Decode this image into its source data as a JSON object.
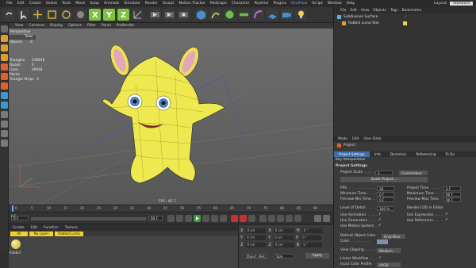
{
  "menubar": {
    "items": [
      "File",
      "Edit",
      "Create",
      "Select",
      "Tools",
      "Mesh",
      "Snap",
      "Animate",
      "Simulate",
      "Render",
      "Sculpt",
      "Motion Tracker",
      "MoGraph",
      "Character",
      "Pipeline",
      "Plugins",
      "RealFlow",
      "Script",
      "Window",
      "Help"
    ],
    "layout_label": "Layout:",
    "layout_value": "Standard"
  },
  "viewport": {
    "menu": [
      "View",
      "Cameras",
      "Display",
      "Options",
      "Filter",
      "Panel",
      "ProRender"
    ],
    "view_name": "Perspective",
    "hud_tab": "Total",
    "stats": [
      {
        "label": "Objects",
        "value": "0"
      },
      {
        "label": "Triangles",
        "value": "130816"
      },
      {
        "label": "Quads",
        "value": "0"
      },
      {
        "label": "Lines",
        "value": "48064"
      },
      {
        "label": "Points",
        "value": ""
      },
      {
        "label": "Triangle Strips",
        "value": "0"
      }
    ],
    "fps": "FPS : 85.7"
  },
  "timeline": {
    "ticks": [
      "0",
      "5",
      "10",
      "15",
      "20",
      "25",
      "30",
      "35",
      "40",
      "45",
      "50",
      "55",
      "60",
      "65",
      "70",
      "75",
      "80",
      "85",
      "90"
    ],
    "start": "0 F",
    "end": "90 F",
    "end2": "90 F",
    "frame": "0 F"
  },
  "material": {
    "menu": [
      "Create",
      "Edit",
      "Function",
      "Texture"
    ],
    "filters": [
      "All",
      "No Layer",
      "Rabbid Luma"
    ],
    "mat_name": "Rabbid"
  },
  "coords": {
    "rows": [
      {
        "a": "X",
        "v1": "0 cm",
        "b": "X",
        "v2": "0 cm",
        "c": "H",
        "v3": "0 °"
      },
      {
        "a": "Y",
        "v1": "0 cm",
        "b": "Y",
        "v2": "0 cm",
        "c": "P",
        "v3": "0 °"
      },
      {
        "a": "Z",
        "v1": "0 cm",
        "b": "Z",
        "v2": "0 cm",
        "c": "B",
        "v3": "0 °"
      }
    ],
    "dd1": "Object (Rel)",
    "dd2": "Size",
    "apply": "Apply"
  },
  "objects": {
    "menu": [
      "File",
      "Edit",
      "View",
      "Objects",
      "Tags",
      "Bookmarks"
    ],
    "rows": [
      "Subdivision Surface",
      "Rabbid Luma Star"
    ]
  },
  "attributes": {
    "menu": [
      "Mode",
      "Edit",
      "User Data"
    ],
    "title": "Project",
    "tabs": [
      "Project Settings",
      "Info",
      "Dynamics",
      "Referencing",
      "To Do"
    ],
    "tab2": "Key Interpolation",
    "section": "Project Settings",
    "project_scale_label": "Project Scale . . . . . .",
    "project_scale": "1",
    "unit": "Centimeters",
    "scale_btn": "Scale Project...",
    "left": [
      {
        "l": "FPS . . . . . . . . . . . . .",
        "v": "30"
      },
      {
        "l": "Minimum Time . . . . . .",
        "v": "0 F"
      },
      {
        "l": "Preview Min Time . . . .",
        "v": "0 F"
      }
    ],
    "right": [
      {
        "l": "Project Time . . . . .",
        "v": "0 F"
      },
      {
        "l": "Maximum Time . . . .",
        "v": "90 F"
      },
      {
        "l": "Preview Max Time .",
        "v": "90 F"
      }
    ],
    "lod_label": "Level of Detail . . . . . .",
    "lod": "100 %",
    "render_lod": "Render LOD in Editor",
    "checks_left": [
      "Use Animation. . . . . . .",
      "Use Generators . . . . .",
      "Use Motion System . . ."
    ],
    "checks_right": [
      "Use Expression . . . .",
      "Use Deformers. . . . ."
    ],
    "color_label": "Default Object Color",
    "color_value": "Gray-Blue",
    "color2": "Color . . . . . . . . .",
    "clip_label": "View Clipping . . . . . .",
    "clip_value": "Medium",
    "linear": "Linear Workflow . . . .",
    "input_profile": "Input Color Profile",
    "profile_value": "sRGB"
  }
}
